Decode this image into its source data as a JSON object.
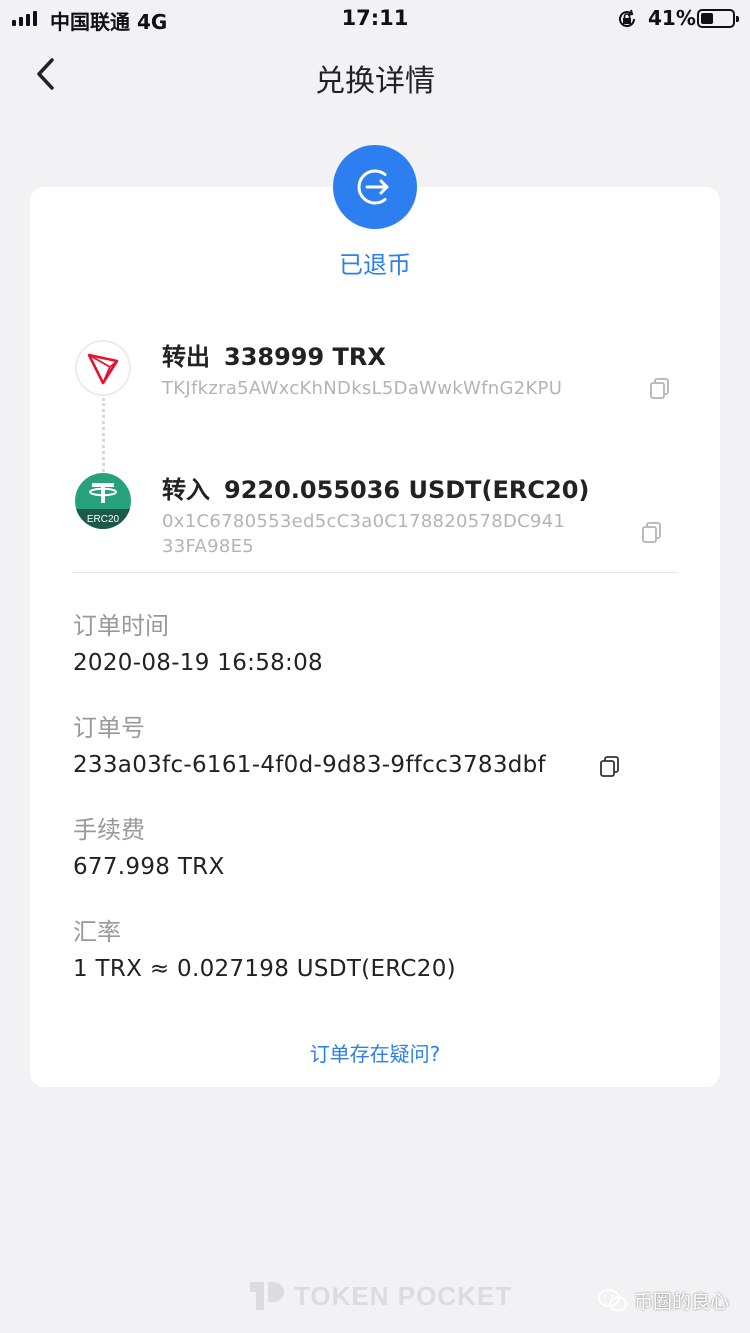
{
  "status_bar": {
    "carrier": "中国联通  4G",
    "time": "17:11",
    "battery_percent": "41%",
    "battery_level": 0.41
  },
  "nav": {
    "title": "兑换详情"
  },
  "status": {
    "text": "已退币",
    "accent_color": "#2d7ff0"
  },
  "transfer_out": {
    "label": "转出",
    "amount": "338999 TRX",
    "address": "TKJfkzra5AWxcKhNDksL5DaWwkWfnG2KPU"
  },
  "transfer_in": {
    "label": "转入",
    "amount": "9220.055036 USDT(ERC20)",
    "address_line1": "0x1C6780553ed5cC3a0C178820578DC941",
    "address_line2": "33FA98E5",
    "coin_badge": "ERC20"
  },
  "details": {
    "order_time_label": "订单时间",
    "order_time": "2020-08-19 16:58:08",
    "order_no_label": "订单号",
    "order_no": "233a03fc-6161-4f0d-9d83-9ffcc3783dbf",
    "fee_label": "手续费",
    "fee": "677.998 TRX",
    "rate_label": "汇率",
    "rate": "1 TRX ≈ 0.027198 USDT(ERC20)"
  },
  "help_link": "订单存在疑问?",
  "footer": {
    "brand": "TOKEN POCKET",
    "watermark": "币圈的良心"
  },
  "icons": {
    "back": "chevron-left-icon",
    "status": "exit-arrow-icon",
    "trx": "tron-logo-icon",
    "usdt": "tether-logo-icon",
    "copy": "copy-icon"
  }
}
